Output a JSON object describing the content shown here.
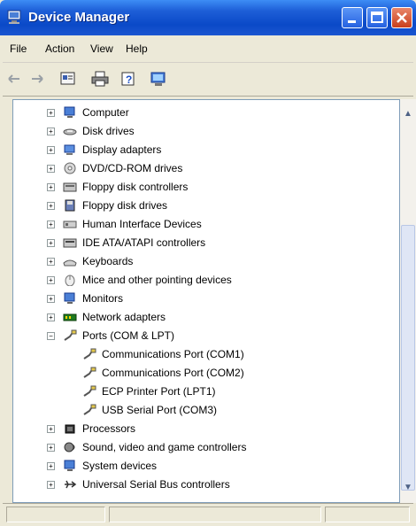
{
  "window": {
    "title": "Device Manager"
  },
  "menu": [
    "File",
    "Action",
    "View",
    "Help"
  ],
  "toolbar": {
    "icons": [
      "back-icon",
      "forward-icon",
      "properties-icon",
      "print-icon",
      "help-icon",
      "computer-view-icon"
    ]
  },
  "tree": {
    "items": [
      {
        "label": "Computer",
        "icon": "computer-icon",
        "expander": "+"
      },
      {
        "label": "Disk drives",
        "icon": "disk-drive-icon",
        "expander": "+"
      },
      {
        "label": "Display adapters",
        "icon": "display-adapter-icon",
        "expander": "+"
      },
      {
        "label": "DVD/CD-ROM drives",
        "icon": "cd-rom-icon",
        "expander": "+"
      },
      {
        "label": "Floppy disk controllers",
        "icon": "floppy-controller-icon",
        "expander": "+"
      },
      {
        "label": "Floppy disk drives",
        "icon": "floppy-drive-icon",
        "expander": "+"
      },
      {
        "label": "Human Interface Devices",
        "icon": "hid-icon",
        "expander": "+"
      },
      {
        "label": "IDE ATA/ATAPI controllers",
        "icon": "ide-controller-icon",
        "expander": "+"
      },
      {
        "label": "Keyboards",
        "icon": "keyboard-icon",
        "expander": "+"
      },
      {
        "label": "Mice and other pointing devices",
        "icon": "mouse-icon",
        "expander": "+"
      },
      {
        "label": "Monitors",
        "icon": "monitor-icon",
        "expander": "+"
      },
      {
        "label": "Network adapters",
        "icon": "network-adapter-icon",
        "expander": "+"
      },
      {
        "label": "Ports (COM & LPT)",
        "icon": "port-icon",
        "expander": "-"
      },
      {
        "label": "Communications Port (COM1)",
        "icon": "port-icon",
        "expander": ""
      },
      {
        "label": "Communications Port (COM2)",
        "icon": "port-icon",
        "expander": ""
      },
      {
        "label": "ECP Printer Port (LPT1)",
        "icon": "port-icon",
        "expander": ""
      },
      {
        "label": "USB Serial Port (COM3)",
        "icon": "port-icon",
        "expander": ""
      },
      {
        "label": "Processors",
        "icon": "processor-icon",
        "expander": "+"
      },
      {
        "label": "Sound, video and game controllers",
        "icon": "sound-icon",
        "expander": "+"
      },
      {
        "label": "System devices",
        "icon": "system-device-icon",
        "expander": "+"
      },
      {
        "label": "Universal Serial Bus controllers",
        "icon": "usb-icon",
        "expander": "+"
      }
    ]
  },
  "colors": {
    "titlebar": "#0a49c8",
    "window_bg": "#ece9d8",
    "tree_bg": "#ffffff"
  }
}
